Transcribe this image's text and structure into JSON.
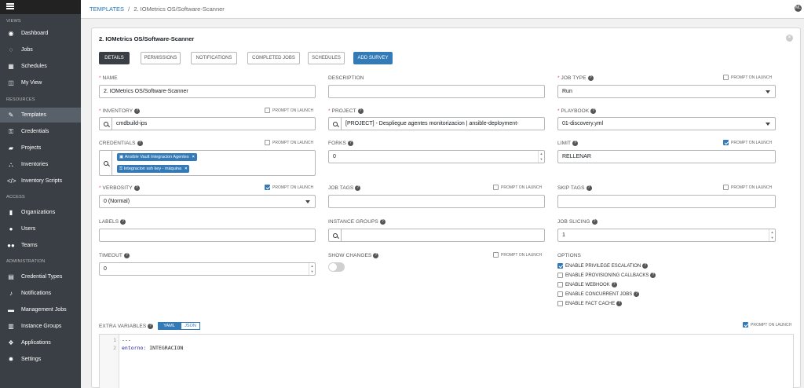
{
  "sidebar": {
    "sections": {
      "views": "VIEWS",
      "resources": "RESOURCES",
      "access": "ACCESS",
      "administration": "ADMINISTRATION"
    },
    "items": [
      {
        "label": "Dashboard",
        "icon": "dashboard-icon"
      },
      {
        "label": "Jobs",
        "icon": "jobs-icon"
      },
      {
        "label": "Schedules",
        "icon": "calendar-icon"
      },
      {
        "label": "My View",
        "icon": "my-view-icon"
      },
      {
        "label": "Templates",
        "icon": "pencil-icon"
      },
      {
        "label": "Credentials",
        "icon": "key-icon"
      },
      {
        "label": "Projects",
        "icon": "folder-icon"
      },
      {
        "label": "Inventories",
        "icon": "sitemap-icon"
      },
      {
        "label": "Inventory Scripts",
        "icon": "code-icon"
      },
      {
        "label": "Organizations",
        "icon": "building-icon"
      },
      {
        "label": "Users",
        "icon": "user-icon"
      },
      {
        "label": "Teams",
        "icon": "users-icon"
      },
      {
        "label": "Credential Types",
        "icon": "id-card-icon"
      },
      {
        "label": "Notifications",
        "icon": "bell-icon"
      },
      {
        "label": "Management Jobs",
        "icon": "briefcase-icon"
      },
      {
        "label": "Instance Groups",
        "icon": "server-icon"
      },
      {
        "label": "Applications",
        "icon": "cubes-icon"
      },
      {
        "label": "Settings",
        "icon": "gear-icon"
      }
    ]
  },
  "header": {
    "crumb_root": "TEMPLATES",
    "crumb_sep": "/",
    "crumb_current": "2. IOMetrics OS/Software-Scanner"
  },
  "form": {
    "title": "2. IOMetrics OS/Software-Scanner",
    "tabs": [
      "DETAILS",
      "PERMISSIONS",
      "NOTIFICATIONS",
      "COMPLETED JOBS",
      "SCHEDULES",
      "ADD SURVEY"
    ],
    "prompt_label": "PROMPT ON LAUNCH",
    "name": {
      "label": "NAME",
      "value": "2. IOMetrics OS/Software-Scanner"
    },
    "description": {
      "label": "DESCRIPTION",
      "value": ""
    },
    "job_type": {
      "label": "JOB TYPE",
      "value": "Run"
    },
    "inventory": {
      "label": "INVENTORY",
      "value": "cmdbuild-ips"
    },
    "project": {
      "label": "PROJECT",
      "value": "[PROJECT] - Despliegue agentes monitorizacion | ansible-deployment-"
    },
    "playbook": {
      "label": "PLAYBOOK",
      "value": "01-discovery.yml"
    },
    "credentials": {
      "label": "CREDENTIALS",
      "chips": [
        "Ansible Vault Integracion Agentes",
        "Integracion ssh key - máquina"
      ]
    },
    "forks": {
      "label": "FORKS",
      "value": "0"
    },
    "limit": {
      "label": "LIMIT",
      "value": "RELLENAR"
    },
    "verbosity": {
      "label": "VERBOSITY",
      "value": "0 (Normal)"
    },
    "job_tags": {
      "label": "JOB TAGS",
      "value": ""
    },
    "skip_tags": {
      "label": "SKIP TAGS",
      "value": ""
    },
    "labels": {
      "label": "LABELS",
      "value": ""
    },
    "instance_groups": {
      "label": "INSTANCE GROUPS",
      "value": ""
    },
    "job_slicing": {
      "label": "JOB SLICING",
      "value": "1"
    },
    "timeout": {
      "label": "TIMEOUT",
      "value": "0"
    },
    "show_changes": {
      "label": "SHOW CHANGES",
      "enabled": false
    },
    "options": {
      "label": "OPTIONS",
      "items": [
        {
          "label": "ENABLE PRIVILEGE ESCALATION",
          "checked": true
        },
        {
          "label": "ENABLE PROVISIONING CALLBACKS",
          "checked": false
        },
        {
          "label": "ENABLE WEBHOOK",
          "checked": false
        },
        {
          "label": "ENABLE CONCURRENT JOBS",
          "checked": false
        },
        {
          "label": "ENABLE FACT CACHE",
          "checked": false
        }
      ]
    },
    "extra_vars": {
      "label": "EXTRA VARIABLES",
      "yaml": "YAML",
      "json": "JSON",
      "lines": [
        "1",
        "2"
      ],
      "line1": "---",
      "line2_key": "entorno:",
      "line2_val": " INTEGRACION"
    }
  },
  "colors": {
    "sidebar": "#393f44",
    "accent": "#337ab7",
    "active_item": "#58606a"
  },
  "avatar": "ML"
}
